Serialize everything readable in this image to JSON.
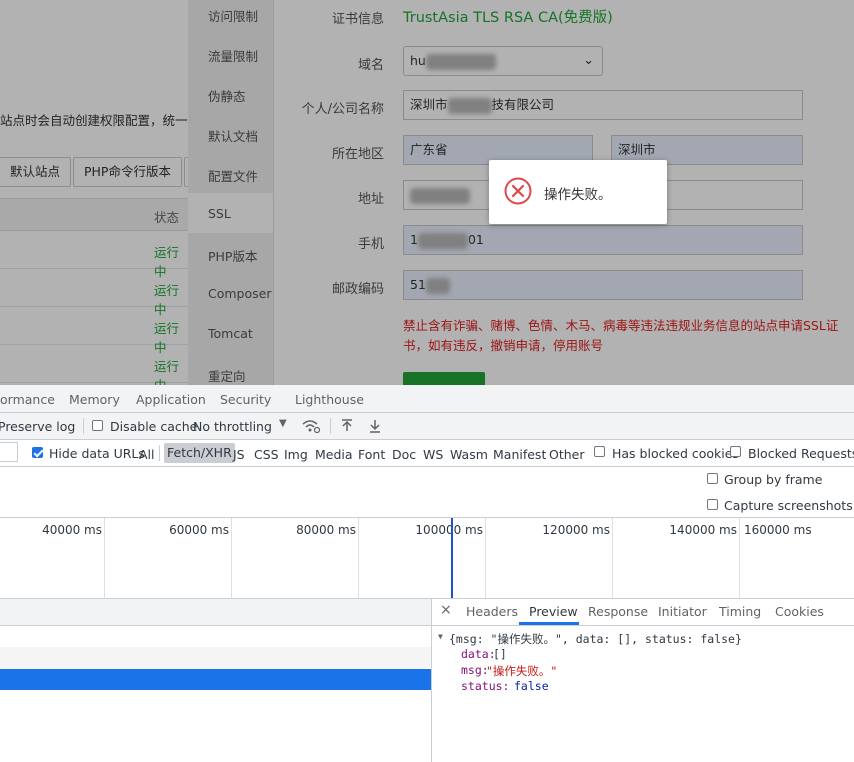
{
  "bg": {
    "hint_text": "站点时会自动创建权限配置，统一使",
    "buttons": [
      "默认站点",
      "PHP命令行版本"
    ],
    "table_header_status": "状态",
    "status_rows": [
      "运行中",
      "运行中",
      "运行中",
      "运行中"
    ]
  },
  "menu": [
    "访问限制",
    "流量限制",
    "伪静态",
    "默认文档",
    "配置文件",
    "SSL",
    "PHP版本",
    "Composer",
    "Tomcat",
    "重定向"
  ],
  "form": {
    "cert_label": "证书信息",
    "cert_value": "TrustAsia TLS RSA CA(免费版)",
    "domain_label": "域名",
    "domain_value": "hu",
    "company_label": "个人/公司名称",
    "company_prefix": "深圳市",
    "company_suffix": "技有限公司",
    "region_label": "所在地区",
    "province": "广东省",
    "city": "深圳市",
    "address_label": "地址",
    "phone_label": "手机",
    "phone_prefix": "1",
    "phone_suffix": "01",
    "zip_label": "邮政编码",
    "zip_prefix": "51",
    "warning": "禁止含有诈骗、赌博、色情、木马、病毒等违法违规业务信息的站点申请SSL证书，如有违反，撤销申请，停用账号"
  },
  "toast": {
    "message": "操作失败。"
  },
  "devtools": {
    "tabs": [
      "ormance",
      "Memory",
      "Application",
      "Security",
      "Lighthouse"
    ],
    "preserve_log": "Preserve log",
    "disable_cache": "Disable cache",
    "throttling": "No throttling",
    "hide_data_urls": "Hide data URLs",
    "filters": [
      "All",
      "Fetch/XHR",
      "JS",
      "CSS",
      "Img",
      "Media",
      "Font",
      "Doc",
      "WS",
      "Wasm",
      "Manifest",
      "Other"
    ],
    "has_blocked_cookies": "Has blocked cookies",
    "blocked_requests": "Blocked Requests",
    "group_by_frame": "Group by frame",
    "capture_screenshots": "Capture screenshots",
    "timeline_labels": [
      "40000 ms",
      "60000 ms",
      "80000 ms",
      "100000 ms",
      "120000 ms",
      "140000 ms",
      "160000 ms"
    ],
    "panel_close": "×",
    "panel_tabs": [
      "Headers",
      "Preview",
      "Response",
      "Initiator",
      "Timing",
      "Cookies"
    ],
    "preview": {
      "summary": "{msg: \"操作失败。\", data: [], status: false}",
      "data_key": "data",
      "data_val": "[]",
      "msg_key": "msg",
      "msg_val": "\"操作失败。\"",
      "status_key": "status",
      "status_val": "false"
    }
  }
}
